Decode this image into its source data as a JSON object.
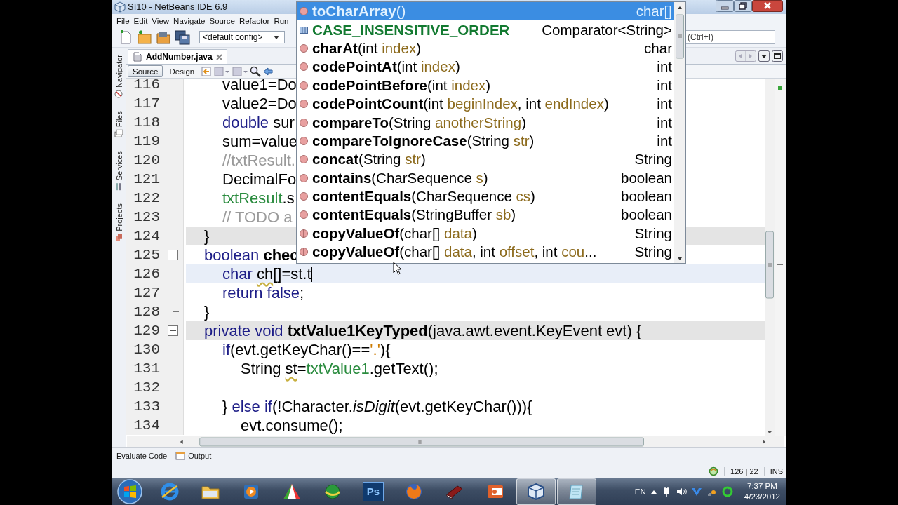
{
  "window": {
    "title": "SI10 - NetBeans IDE 6.9"
  },
  "menu": [
    "File",
    "Edit",
    "View",
    "Navigate",
    "Source",
    "Refactor",
    "Run"
  ],
  "toolbar": {
    "config": "<default config>",
    "search": {
      "placeholder": "(Ctrl+I)"
    }
  },
  "side_tabs": [
    {
      "label": "Navigator"
    },
    {
      "label": "Files"
    },
    {
      "label": "Services"
    },
    {
      "label": "Projects"
    }
  ],
  "editor_tabs": [
    {
      "label": "AddNumber.java",
      "selected": true
    }
  ],
  "view_buttons": [
    {
      "label": "Source",
      "selected": true
    },
    {
      "label": "Design",
      "selected": false
    }
  ],
  "code": {
    "lines": [
      {
        "number": "116",
        "fold_start": false,
        "fold_end": false,
        "marked": false,
        "current": false,
        "tokens": [
          {
            "kind": "plain",
            "text": "\t\tvalue1=Do"
          }
        ]
      },
      {
        "number": "117",
        "fold_start": false,
        "fold_end": false,
        "marked": false,
        "current": false,
        "tokens": [
          {
            "kind": "plain",
            "text": "\t\tvalue2=Do"
          }
        ]
      },
      {
        "number": "118",
        "fold_start": false,
        "fold_end": false,
        "marked": false,
        "current": false,
        "tokens": [
          {
            "kind": "keyword",
            "text": "\t\tdouble"
          },
          {
            "kind": "plain",
            "text": " sur"
          }
        ]
      },
      {
        "number": "119",
        "fold_start": false,
        "fold_end": false,
        "marked": false,
        "current": false,
        "tokens": [
          {
            "kind": "plain",
            "text": "\t\tsum=value"
          }
        ]
      },
      {
        "number": "120",
        "fold_start": false,
        "fold_end": false,
        "marked": false,
        "current": false,
        "tokens": [
          {
            "kind": "comment",
            "text": "\t\t//txtResult."
          }
        ]
      },
      {
        "number": "121",
        "fold_start": false,
        "fold_end": false,
        "marked": false,
        "current": false,
        "tokens": [
          {
            "kind": "plain",
            "text": "\t\tDecimalFo"
          }
        ]
      },
      {
        "number": "122",
        "fold_start": false,
        "fold_end": false,
        "marked": false,
        "current": false,
        "tokens": [
          {
            "kind": "field",
            "text": "\t\ttxtResult"
          },
          {
            "kind": "plain",
            "text": ".s"
          }
        ]
      },
      {
        "number": "123",
        "fold_start": false,
        "fold_end": false,
        "marked": false,
        "current": false,
        "tokens": [
          {
            "kind": "comment",
            "text": "\t\t// TODO a"
          }
        ]
      },
      {
        "number": "124",
        "fold_start": false,
        "fold_end": true,
        "marked": true,
        "current": false,
        "tokens": [
          {
            "kind": "plain",
            "text": "\t}"
          }
        ]
      },
      {
        "number": "125",
        "fold_start": true,
        "fold_end": false,
        "marked": false,
        "current": false,
        "tokens": [
          {
            "kind": "keyword",
            "text": "\tboolean "
          },
          {
            "kind": "bold",
            "text": "chec"
          }
        ]
      },
      {
        "number": "126",
        "fold_start": false,
        "fold_end": false,
        "marked": false,
        "current": true,
        "tokens": [
          {
            "kind": "keyword",
            "text": "\t\tchar "
          },
          {
            "kind": "warning",
            "text": "ch"
          },
          {
            "kind": "plain",
            "text": "[]=st.t"
          }
        ]
      },
      {
        "number": "127",
        "fold_start": false,
        "fold_end": false,
        "marked": false,
        "current": false,
        "tokens": [
          {
            "kind": "keyword",
            "text": "\t\treturn false"
          },
          {
            "kind": "plain",
            "text": ";"
          }
        ]
      },
      {
        "number": "128",
        "fold_start": false,
        "fold_end": true,
        "marked": false,
        "current": false,
        "tokens": [
          {
            "kind": "plain",
            "text": "\t}"
          }
        ]
      },
      {
        "number": "129",
        "fold_start": true,
        "fold_end": false,
        "marked": true,
        "current": false,
        "tokens": [
          {
            "kind": "keyword",
            "text": "\tprivate void "
          },
          {
            "kind": "bold",
            "text": "txtValue1KeyTyped"
          },
          {
            "kind": "plain",
            "text": "(java.awt.event.KeyEvent evt) {"
          }
        ]
      },
      {
        "number": "130",
        "fold_start": false,
        "fold_end": false,
        "marked": false,
        "current": false,
        "tokens": [
          {
            "kind": "keyword",
            "text": "\t\tif"
          },
          {
            "kind": "plain",
            "text": "(evt.getKeyChar()=="
          },
          {
            "kind": "string",
            "text": "'.'"
          },
          {
            "kind": "plain",
            "text": "){"
          }
        ]
      },
      {
        "number": "131",
        "fold_start": false,
        "fold_end": false,
        "marked": false,
        "current": false,
        "tokens": [
          {
            "kind": "plain",
            "text": "\t\t\tString "
          },
          {
            "kind": "warning",
            "text": "st"
          },
          {
            "kind": "plain",
            "text": "="
          },
          {
            "kind": "field",
            "text": "txtValue1"
          },
          {
            "kind": "plain",
            "text": ".getText();"
          }
        ]
      },
      {
        "number": "132",
        "fold_start": false,
        "fold_end": false,
        "marked": false,
        "current": false
      },
      {
        "number": "133",
        "fold_start": false,
        "fold_end": false,
        "marked": false,
        "current": false,
        "tokens": [
          {
            "kind": "plain",
            "text": "\t\t} "
          },
          {
            "kind": "keyword",
            "text": "else if"
          },
          {
            "kind": "plain",
            "text": "(!Character."
          },
          {
            "kind": "italic",
            "text": "isDigit"
          },
          {
            "kind": "plain",
            "text": "(evt.getKeyChar())){"
          }
        ]
      },
      {
        "number": "134",
        "fold_start": false,
        "fold_end": false,
        "marked": false,
        "current": false,
        "tokens": [
          {
            "kind": "plain",
            "text": "\t\t\tevt.consume();"
          }
        ]
      }
    ]
  },
  "completion": {
    "items": [
      {
        "kind": "method",
        "name": "toCharArray",
        "signature": [
          {
            "kind": "type",
            "text": "()"
          }
        ],
        "returns": "char[]",
        "selected": true
      },
      {
        "kind": "field",
        "name": "CASE_INSENSITIVE_ORDER",
        "returns": "Comparator<String>",
        "selected": false
      },
      {
        "kind": "method",
        "name": "charAt",
        "signature": [
          {
            "kind": "type",
            "text": "(int "
          },
          {
            "kind": "param",
            "text": "index"
          },
          {
            "kind": "type",
            "text": ")"
          }
        ],
        "returns": "char",
        "selected": false
      },
      {
        "kind": "method",
        "name": "codePointAt",
        "signature": [
          {
            "kind": "type",
            "text": "(int "
          },
          {
            "kind": "param",
            "text": "index"
          },
          {
            "kind": "type",
            "text": ")"
          }
        ],
        "returns": "int",
        "selected": false
      },
      {
        "kind": "method",
        "name": "codePointBefore",
        "signature": [
          {
            "kind": "type",
            "text": "(int "
          },
          {
            "kind": "param",
            "text": "index"
          },
          {
            "kind": "type",
            "text": ")"
          }
        ],
        "returns": "int",
        "selected": false
      },
      {
        "kind": "method",
        "name": "codePointCount",
        "signature": [
          {
            "kind": "type",
            "text": "(int "
          },
          {
            "kind": "param",
            "text": "beginIndex"
          },
          {
            "kind": "type",
            "text": ", int "
          },
          {
            "kind": "param",
            "text": "endIndex"
          },
          {
            "kind": "type",
            "text": ")"
          }
        ],
        "returns": "int",
        "selected": false
      },
      {
        "kind": "method",
        "name": "compareTo",
        "signature": [
          {
            "kind": "type",
            "text": "(String "
          },
          {
            "kind": "param",
            "text": "anotherString"
          },
          {
            "kind": "type",
            "text": ")"
          }
        ],
        "returns": "int",
        "selected": false
      },
      {
        "kind": "method",
        "name": "compareToIgnoreCase",
        "signature": [
          {
            "kind": "type",
            "text": "(String "
          },
          {
            "kind": "param",
            "text": "str"
          },
          {
            "kind": "type",
            "text": ")"
          }
        ],
        "returns": "int",
        "selected": false
      },
      {
        "kind": "method",
        "name": "concat",
        "signature": [
          {
            "kind": "type",
            "text": "(String "
          },
          {
            "kind": "param",
            "text": "str"
          },
          {
            "kind": "type",
            "text": ")"
          }
        ],
        "returns": "String",
        "selected": false
      },
      {
        "kind": "method",
        "name": "contains",
        "signature": [
          {
            "kind": "type",
            "text": "(CharSequence "
          },
          {
            "kind": "param",
            "text": "s"
          },
          {
            "kind": "type",
            "text": ")"
          }
        ],
        "returns": "boolean",
        "selected": false
      },
      {
        "kind": "method",
        "name": "contentEquals",
        "signature": [
          {
            "kind": "type",
            "text": "(CharSequence "
          },
          {
            "kind": "param",
            "text": "cs"
          },
          {
            "kind": "type",
            "text": ")"
          }
        ],
        "returns": "boolean",
        "selected": false
      },
      {
        "kind": "method",
        "name": "contentEquals",
        "signature": [
          {
            "kind": "type",
            "text": "(StringBuffer "
          },
          {
            "kind": "param",
            "text": "sb"
          },
          {
            "kind": "type",
            "text": ")"
          }
        ],
        "returns": "boolean",
        "selected": false
      },
      {
        "kind": "static",
        "name": "copyValueOf",
        "signature": [
          {
            "kind": "type",
            "text": "(char[] "
          },
          {
            "kind": "param",
            "text": "data"
          },
          {
            "kind": "type",
            "text": ")"
          }
        ],
        "returns": "String",
        "selected": false
      },
      {
        "kind": "static",
        "name": "copyValueOf",
        "signature": [
          {
            "kind": "type",
            "text": "(char[] "
          },
          {
            "kind": "param",
            "text": "data"
          },
          {
            "kind": "type",
            "text": ", int "
          },
          {
            "kind": "param",
            "text": "offset"
          },
          {
            "kind": "type",
            "text": ", int "
          },
          {
            "kind": "param",
            "text": "cou"
          },
          {
            "kind": "type",
            "text": "..."
          }
        ],
        "returns": "String",
        "selected": false
      }
    ]
  },
  "bottom_tabs": [
    {
      "label": "Evaluate Code"
    },
    {
      "label": "Output"
    }
  ],
  "status": {
    "position": "126 | 22",
    "mode": "INS"
  },
  "taskbar": {
    "apps": [
      {
        "kind": "ie",
        "active": false
      },
      {
        "kind": "folder",
        "active": false
      },
      {
        "kind": "media",
        "active": false
      },
      {
        "kind": "paint",
        "active": false
      },
      {
        "kind": "globe",
        "active": false
      },
      {
        "kind": "ps",
        "label": "Ps",
        "active": false
      },
      {
        "kind": "firefox",
        "active": false
      },
      {
        "kind": "book",
        "active": false
      },
      {
        "kind": "slides",
        "active": false
      },
      {
        "kind": "cube",
        "active": true
      },
      {
        "kind": "notepad",
        "active": true
      }
    ],
    "language": "EN",
    "time": "7:37 PM",
    "date": "4/23/2012"
  }
}
